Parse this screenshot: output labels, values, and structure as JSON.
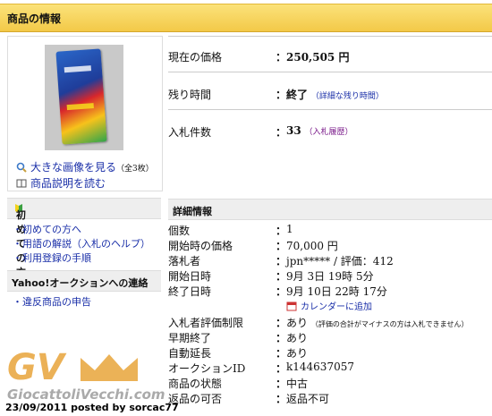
{
  "header": {
    "title": "商品の情報"
  },
  "gallery": {
    "enlarge_label": "大きな画像を見る",
    "count": "（全3枚）",
    "desc_label": "商品説明を読む"
  },
  "summary": {
    "price_label": "現在の価格",
    "price_value": "250,505 円",
    "time_label": "残り時間",
    "time_value": "終了",
    "time_link": "（詳細な残り時間）",
    "bids_label": "入札件数",
    "bids_value": "33",
    "bids_link": "（入札履歴）"
  },
  "sidebar": {
    "beginner_title": "初めての方",
    "beginner_items": [
      "初めての方へ",
      "用語の解説（入札のヘルプ）",
      "利用登録の手順"
    ],
    "contact_title": "Yahoo!オークションへの連絡",
    "contact_items": [
      "違反商品の申告"
    ]
  },
  "details": {
    "title": "詳細情報",
    "rows": [
      {
        "label": "個数",
        "value": "1"
      },
      {
        "label": "開始時の価格",
        "value": "70,000 円"
      },
      {
        "label": "落札者",
        "value": "jpn***** / 評価：412"
      },
      {
        "label": "開始日時",
        "value": "9月 3日 19時 5分"
      },
      {
        "label": "終了日時",
        "value": "9月 10日 22時 17分"
      }
    ],
    "calendar_link": "カレンダーに追加",
    "rows2": [
      {
        "label": "入札者評価制限",
        "value": "あり",
        "note": "（評価の合計がマイナスの方は入札できません）"
      },
      {
        "label": "早期終了",
        "value": "あり"
      },
      {
        "label": "自動延長",
        "value": "あり"
      },
      {
        "label": "オークションID",
        "value": "k144637057"
      },
      {
        "label": "商品の状態",
        "value": "中古"
      },
      {
        "label": "返品の可否",
        "value": "返品不可"
      }
    ]
  },
  "watermark": {
    "logo": "GV",
    "site": "GiocattoliVecchi.com",
    "credit": "23/09/2011 posted by sorcac77"
  },
  "colors": {
    "header": "#f3c948",
    "link": "#1a2fa8",
    "visited": "#7a1a8a",
    "brand": "#e8a43a"
  }
}
